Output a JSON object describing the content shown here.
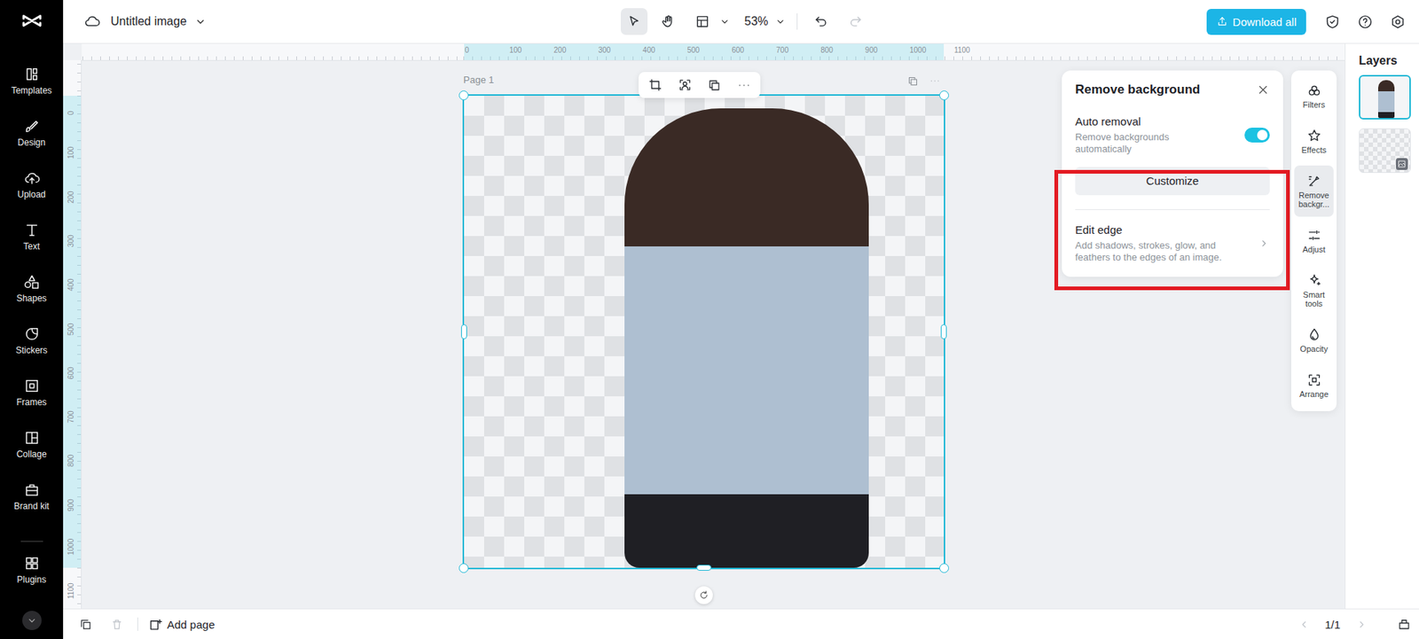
{
  "topbar": {
    "title": "Untitled image",
    "tools": [
      {
        "kind": "select",
        "selected": true,
        "dropdown": false
      },
      {
        "kind": "hand",
        "selected": false,
        "dropdown": false
      },
      {
        "kind": "layout",
        "selected": false,
        "dropdown": true
      }
    ],
    "zoom": "53%",
    "history": [
      {
        "kind": "undo",
        "disabled": false
      },
      {
        "kind": "redo",
        "disabled": true
      }
    ],
    "download_button": "Download all"
  },
  "sidebar": {
    "items": [
      {
        "label": "Templates",
        "kind": "templates",
        "selected": false
      },
      {
        "label": "Design",
        "kind": "design",
        "selected": false
      },
      {
        "label": "Upload",
        "kind": "upload",
        "selected": false
      },
      {
        "label": "Text",
        "kind": "text",
        "selected": false
      },
      {
        "label": "Shapes",
        "kind": "shapes",
        "selected": false
      },
      {
        "label": "Stickers",
        "kind": "stickers",
        "selected": false
      },
      {
        "label": "Frames",
        "kind": "frames",
        "selected": false
      },
      {
        "label": "Collage",
        "kind": "collage",
        "selected": false
      },
      {
        "label": "Brand kit",
        "kind": "brand",
        "selected": false
      }
    ],
    "footer_items": [
      {
        "label": "Plugins",
        "kind": "plugins",
        "selected": false
      }
    ]
  },
  "canvas": {
    "ruler_top": [
      "0",
      "100",
      "200",
      "300",
      "400",
      "500",
      "600",
      "700",
      "800",
      "900",
      "1000",
      "1100"
    ],
    "ruler_left": [
      "0",
      "100",
      "200",
      "300",
      "400",
      "500",
      "600",
      "700",
      "800",
      "900",
      "1000",
      "1100"
    ],
    "page_label": "Page 1",
    "page_selected": true
  },
  "remove_background": {
    "title": "Remove background",
    "highlighted": true,
    "auto_removal": {
      "label": "Auto removal",
      "description": "Remove backgrounds automatically",
      "on": true
    },
    "customize_button": "Customize",
    "edit_edge": {
      "title": "Edit edge",
      "description": "Add shadows, strokes, glow, and feathers to the edges of an image."
    }
  },
  "properties": [
    {
      "label": "Filters",
      "kind": "filters",
      "selected": false
    },
    {
      "label": "Effects",
      "kind": "effects",
      "selected": false
    },
    {
      "label": "Remove backgr...",
      "kind": "remove_bg",
      "selected": true
    },
    {
      "label": "Adjust",
      "kind": "adjust",
      "selected": false
    },
    {
      "label": "Smart tools",
      "kind": "smart",
      "selected": false
    },
    {
      "label": "Opacity",
      "kind": "opacity",
      "selected": false
    },
    {
      "label": "Arrange",
      "kind": "arrange",
      "selected": false
    }
  ],
  "layers": {
    "title": "Layers",
    "items": [
      {
        "kind": "photo",
        "selected": true
      },
      {
        "kind": "background",
        "selected": false
      }
    ]
  },
  "bottom_bar": {
    "delete_disabled": true,
    "add_page": "Add page",
    "counter": "1/1",
    "prev_disabled": true,
    "next_disabled": true
  }
}
